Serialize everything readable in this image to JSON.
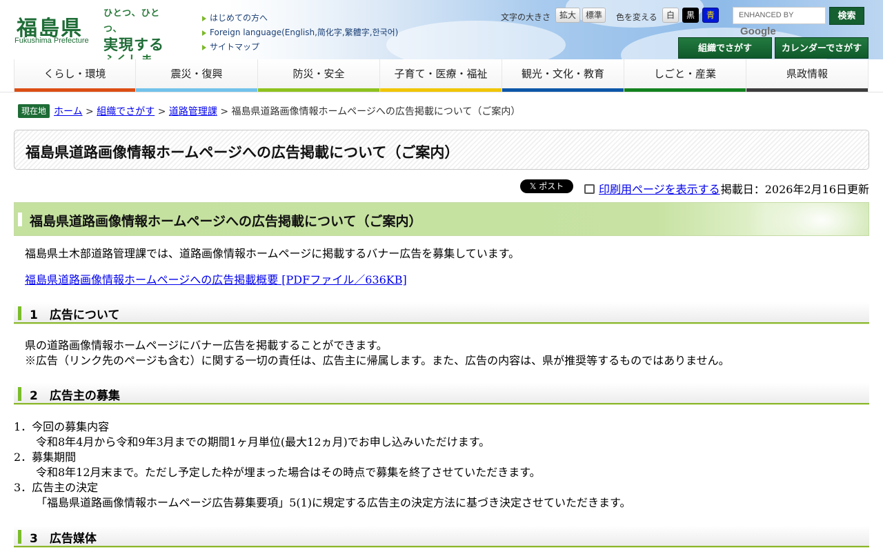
{
  "header": {
    "logo_text": "福島県",
    "logo_subtitle": "Fukushima Prefecture",
    "slogan": [
      "ひとつ、ひとつ、",
      "実現する",
      "ふくしま"
    ],
    "links": [
      "はじめての方へ",
      "Foreign language(English,简化字,繁體字,한국어)",
      "サイトマップ"
    ],
    "font_size_label": "文字の大きさ",
    "font_enlarge": "拡大",
    "font_standard": "標準",
    "color_label": "色を変える",
    "color_white": "白",
    "color_black": "黒",
    "color_blue": "青",
    "search_placeholder_prefix": "ENHANCED BY",
    "search_placeholder_brand": "Google",
    "search_button": "検索",
    "org_button": "組織でさがす",
    "calendar_button": "カレンダーでさがす"
  },
  "nav": [
    {
      "label": "くらし・環境",
      "color": "#dc4e14"
    },
    {
      "label": "震災・復興",
      "color": "#71c2ea"
    },
    {
      "label": "防災・安全",
      "color": "#8ec21f"
    },
    {
      "label": "子育て・医療・福祉",
      "color": "#f0c600"
    },
    {
      "label": "観光・文化・教育",
      "color": "#0c56a8"
    },
    {
      "label": "しごと・産業",
      "color": "#13821f"
    },
    {
      "label": "県政情報",
      "color": "#3c3c3c"
    }
  ],
  "breadcrumb": {
    "here_label": "現在地",
    "items": [
      "ホーム",
      "組織でさがす",
      "道路管理課"
    ],
    "current": "福島県道路画像情報ホームページへの広告掲載について（ご案内）",
    "sep": " > "
  },
  "page": {
    "title": "福島県道路画像情報ホームページへの広告掲載について（ご案内）",
    "post_button": "𝕏 ポスト",
    "print_link": "印刷用ページを表示する",
    "published": "掲載日：2026年2月16日更新",
    "h2": "福島県道路画像情報ホームページへの広告掲載について（ご案内）",
    "intro": "福島県土木部道路管理課では、道路画像情報ホームページに掲載するバナー広告を募集しています。",
    "pdf_link": "福島県道路画像情報ホームページへの広告掲載概要 [PDFファイル／636KB]",
    "sections": [
      {
        "num": "1",
        "title": "広告について"
      },
      {
        "num": "2",
        "title": "広告主の募集"
      },
      {
        "num": "3",
        "title": "広告媒体"
      }
    ],
    "sec1_lines": [
      "県の道路画像情報ホームページにバナー広告を掲載することができます。",
      "※広告（リンク先のページも含む）に関する一切の責任は、広告主に帰属します。また、広告の内容は、県が推奨等するものではありません。"
    ],
    "sec2_items": [
      {
        "head": "1．今回の募集内容",
        "body": "令和8年4月から令和9年3月までの期間1ヶ月単位(最大12ヵ月)でお申し込みいただけます。"
      },
      {
        "head": "2．募集期間",
        "body": "令和8年12月末まで。ただし予定した枠が埋まった場合はその時点で募集を終了させていただきます。"
      },
      {
        "head": "3．広告主の決定",
        "body": "「福島県道路画像情報ホームページ広告募集要項」5(1)に規定する広告主の決定方法に基づき決定させていただきます。"
      }
    ]
  }
}
